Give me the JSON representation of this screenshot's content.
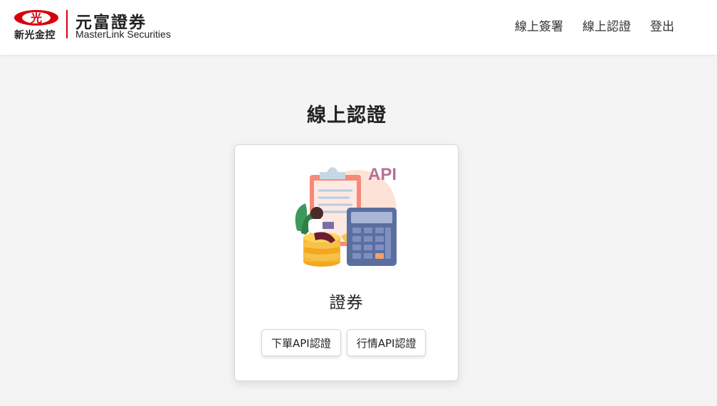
{
  "header": {
    "brand_parent_name": "新光金控",
    "brand_name_cn": "元富證券",
    "brand_name_en": "MasterLink Securities",
    "brand_color": "#d7000f",
    "nav": [
      {
        "label": "線上簽署"
      },
      {
        "label": "線上認證"
      },
      {
        "label": "登出"
      }
    ]
  },
  "main": {
    "title": "線上認證",
    "card": {
      "illustration_label": "API",
      "illustration_icon": "api-calculator-coins-illustration",
      "title": "證券",
      "buttons": [
        {
          "label": "下單API認證"
        },
        {
          "label": "行情API認證"
        }
      ]
    }
  }
}
